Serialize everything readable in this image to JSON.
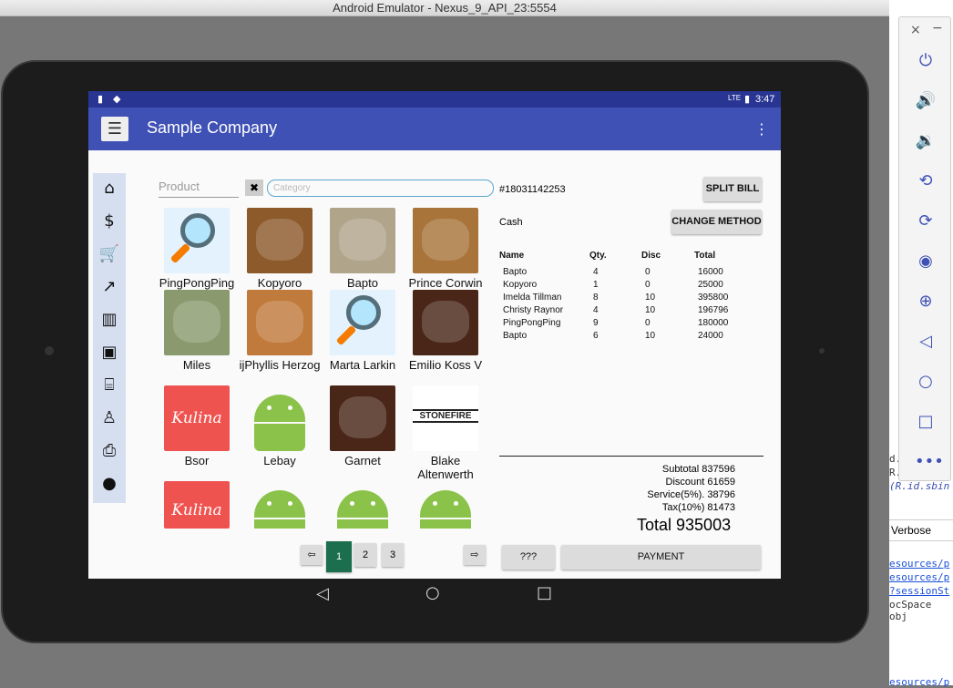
{
  "window": {
    "title": "Android Emulator - Nexus_9_API_23:5554"
  },
  "status_bar": {
    "time": "3:47",
    "network": "LTE"
  },
  "app_bar": {
    "title": "Sample Company",
    "menu_icon": "menu-icon",
    "overflow_icon": "more-vert-icon"
  },
  "sidebar": {
    "items": [
      {
        "icon": "home-icon",
        "glyph": "⌂"
      },
      {
        "icon": "dollar-icon",
        "glyph": "$"
      },
      {
        "icon": "cart-icon",
        "glyph": "🛒"
      },
      {
        "icon": "chart-line-icon",
        "glyph": "↗"
      },
      {
        "icon": "bar-chart-icon",
        "glyph": "▥"
      },
      {
        "icon": "box-icon",
        "glyph": "▣"
      },
      {
        "icon": "warehouse-icon",
        "glyph": "⌸"
      },
      {
        "icon": "user-desk-icon",
        "glyph": "♙"
      },
      {
        "icon": "printer-icon",
        "glyph": "⎙"
      },
      {
        "icon": "person-icon",
        "glyph": "●"
      }
    ]
  },
  "search": {
    "product_placeholder": "Product",
    "category_placeholder": "Category",
    "clear_label": "✖"
  },
  "products": [
    {
      "name": "PingPongPing",
      "image": "magnifier",
      "color": "#e3f2fd"
    },
    {
      "name": "Kopyoro",
      "image": "food",
      "color": "#8d5a2b"
    },
    {
      "name": "Bapto",
      "image": "food",
      "color": "#b0a48a"
    },
    {
      "name": "Prince Corwin",
      "image": "food",
      "color": "#a8743a"
    },
    {
      "name": "Miles",
      "image": "food",
      "color": "#8a9a6e"
    },
    {
      "name": "ijPhyllis Herzog",
      "image": "food",
      "color": "#c07a3c"
    },
    {
      "name": "Marta Larkin",
      "image": "magnifier",
      "color": "#e3f2fd"
    },
    {
      "name": "Emilio Koss V",
      "image": "food",
      "color": "#4a2618"
    },
    {
      "name": "Bsor",
      "image": "kulina",
      "color": "#ef5350"
    },
    {
      "name": "Lebay",
      "image": "android",
      "color": "#8bc34a"
    },
    {
      "name": "Garnet",
      "image": "food",
      "color": "#4a2618"
    },
    {
      "name": "Blake Altenwerth",
      "image": "stonefire",
      "color": "#ffffff"
    },
    {
      "name": "",
      "image": "kulina",
      "color": "#ef5350"
    },
    {
      "name": "",
      "image": "android",
      "color": "#8bc34a"
    },
    {
      "name": "",
      "image": "android",
      "color": "#8bc34a"
    },
    {
      "name": "",
      "image": "android",
      "color": "#8bc34a"
    }
  ],
  "kulina_text": "Kulina",
  "stonefire_text": "STONEFIRE",
  "pagination": {
    "prev": "⇦",
    "next": "⇨",
    "pages": [
      "1",
      "2",
      "3"
    ],
    "active": "1"
  },
  "order": {
    "id": "#18031142253",
    "payment_method": "Cash",
    "split_label": "SPLIT BILL",
    "change_method_label": "CHANGE METHOD",
    "columns": [
      "Name",
      "Qty.",
      "Disc",
      "Total"
    ],
    "rows": [
      [
        "Bapto",
        "4",
        "0",
        "16000"
      ],
      [
        "Kopyoro",
        "1",
        "0",
        "25000"
      ],
      [
        "Imelda Tillman",
        "8",
        "10",
        "395800"
      ],
      [
        "Christy Raynor",
        "4",
        "10",
        "196796"
      ],
      [
        "PingPongPing",
        "9",
        "0",
        "180000"
      ],
      [
        "Bapto",
        "6",
        "10",
        "24000"
      ]
    ],
    "summary": {
      "subtotal": "Subtotal  837596",
      "discount": "Discount  61659",
      "service": "Service(5%).  38796",
      "tax": "Tax(10%)  81473",
      "total": "Total 935003"
    },
    "misc_label": "???",
    "payment_label": "PAYMENT"
  },
  "colors": {
    "primary": "#3f51b5",
    "primary_dark": "#283593",
    "active_page": "#1b6e4e"
  },
  "ide": {
    "verbose_label": "Verbose",
    "lines": [
      "d.",
      "R.",
      "(R.id.sbin",
      "esources/p",
      "esources/p",
      "?sessionSt",
      "ocSpace obj",
      "esources/p"
    ]
  }
}
